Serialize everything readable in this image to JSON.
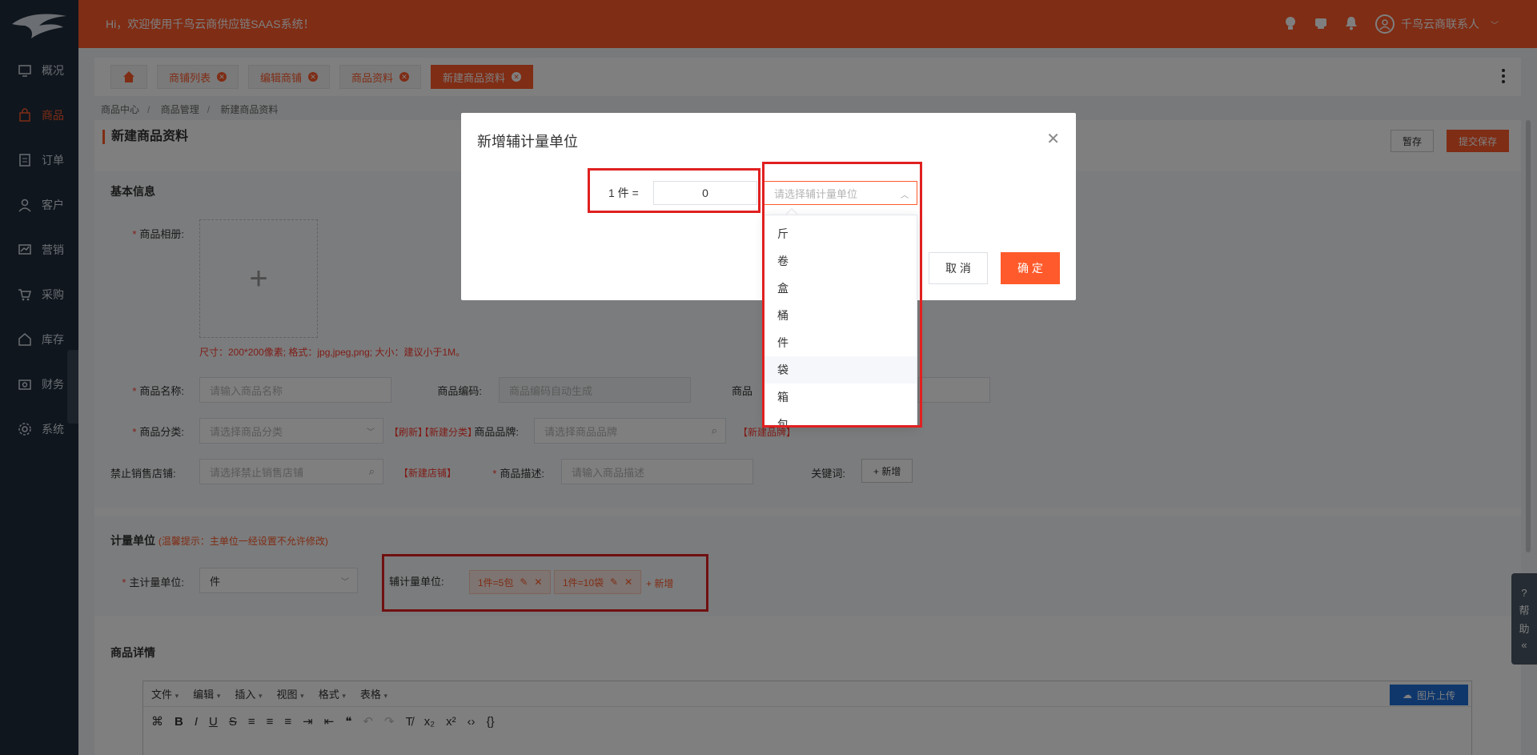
{
  "header": {
    "welcome": "Hi，欢迎使用千鸟云商供应链SAAS系统！",
    "user": "千鸟云商联系人"
  },
  "sidebar": {
    "items": [
      {
        "label": "概况",
        "icon": "monitor-icon"
      },
      {
        "label": "商品",
        "icon": "bag-icon",
        "active": true
      },
      {
        "label": "订单",
        "icon": "document-icon"
      },
      {
        "label": "客户",
        "icon": "user-icon"
      },
      {
        "label": "营销",
        "icon": "chart-icon"
      },
      {
        "label": "采购",
        "icon": "cart-icon"
      },
      {
        "label": "库存",
        "icon": "house-icon"
      },
      {
        "label": "财务",
        "icon": "wallet-icon"
      },
      {
        "label": "系统",
        "icon": "gear-icon"
      }
    ]
  },
  "tabs": [
    "商铺列表",
    "编辑商铺",
    "商品资料",
    "新建商品资料"
  ],
  "breadcrumb": [
    "商品中心",
    "商品管理",
    "新建商品资料"
  ],
  "page": {
    "title": "新建商品资料",
    "save_draft": "暂存",
    "submit": "提交保存"
  },
  "basic": {
    "title": "基本信息",
    "album_label": "商品相册:",
    "upload_hint": "尺寸：200*200像素; 格式：jpg,jpeg,png; 大小：建议小于1M。",
    "name_label": "商品名称:",
    "name_placeholder": "请输入商品名称",
    "code_label": "商品编码:",
    "code_placeholder": "商品编码自动生成",
    "extra_label": "商品",
    "category_label": "商品分类:",
    "category_placeholder": "请选择商品分类",
    "refresh_link": "【刷新】",
    "new_category_link": "【新建分类】",
    "brand_label": "商品品牌:",
    "brand_placeholder": "请选择商品品牌",
    "new_brand_link": "【新建品牌】",
    "ban_shop_label": "禁止销售店铺:",
    "ban_shop_placeholder": "请选择禁止销售店铺",
    "new_shop_link": "【新建店铺】",
    "desc_label": "商品描述:",
    "desc_placeholder": "请输入商品描述",
    "keyword_label": "关键词:",
    "keyword_add": "+ 新增"
  },
  "unit": {
    "title": "计量单位",
    "tip": "(温馨提示：主单位一经设置不允许修改)",
    "main_label": "主计量单位:",
    "main_value": "件",
    "aux_label": "辅计量单位:",
    "aux_chips": [
      "1件=5包",
      "1件=10袋"
    ],
    "aux_add": "+ 新增"
  },
  "detail": {
    "title": "商品详情",
    "menus": [
      "文件",
      "编辑",
      "插入",
      "视图",
      "格式",
      "表格"
    ],
    "upload_image": "图片上传"
  },
  "help": {
    "label1": "帮",
    "label2": "助",
    "collapse": "«"
  },
  "modal": {
    "title": "新增辅计量单位",
    "equation_label": "1 件 =",
    "quantity_value": "0",
    "select_placeholder": "请选择辅计量单位",
    "cancel": "取 消",
    "confirm": "确 定",
    "options": [
      "斤",
      "卷",
      "盒",
      "桶",
      "件",
      "袋",
      "箱",
      "包"
    ]
  },
  "colors": {
    "accent": "#ff5a2b",
    "sidebar": "#1f2d3d",
    "highlight_box": "#e02020"
  }
}
